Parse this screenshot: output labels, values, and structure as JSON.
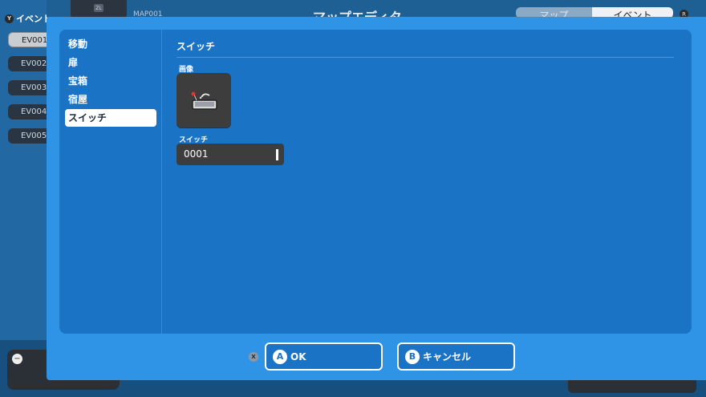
{
  "background": {
    "event_tab_label": "イベント",
    "y_badge": "Y",
    "zl_label": "ZL",
    "map_id": "MAP001",
    "title": "マップエディタ",
    "tabs": [
      "マップ",
      "イベント"
    ],
    "r_badge": "R",
    "events": [
      "EV001",
      "EV002",
      "EV003",
      "EV004",
      "EV005"
    ],
    "minus_badge": "−"
  },
  "dialog": {
    "categories": [
      "移動",
      "扉",
      "宝箱",
      "宿屋",
      "スイッチ"
    ],
    "selected_category": "スイッチ",
    "section_title": "スイッチ",
    "image_label": "画像",
    "image_icon": "switch-lever-icon",
    "switch_label": "スイッチ",
    "switch_value": "0001",
    "x_badge": "X",
    "ok_button": {
      "badge": "A",
      "label": "OK"
    },
    "cancel_button": {
      "badge": "B",
      "label": "キャンセル"
    }
  },
  "colors": {
    "dialog_bg": "#2f93e6",
    "panel_bg": "#1b73c6",
    "field_bg": "#3d3d3d"
  }
}
